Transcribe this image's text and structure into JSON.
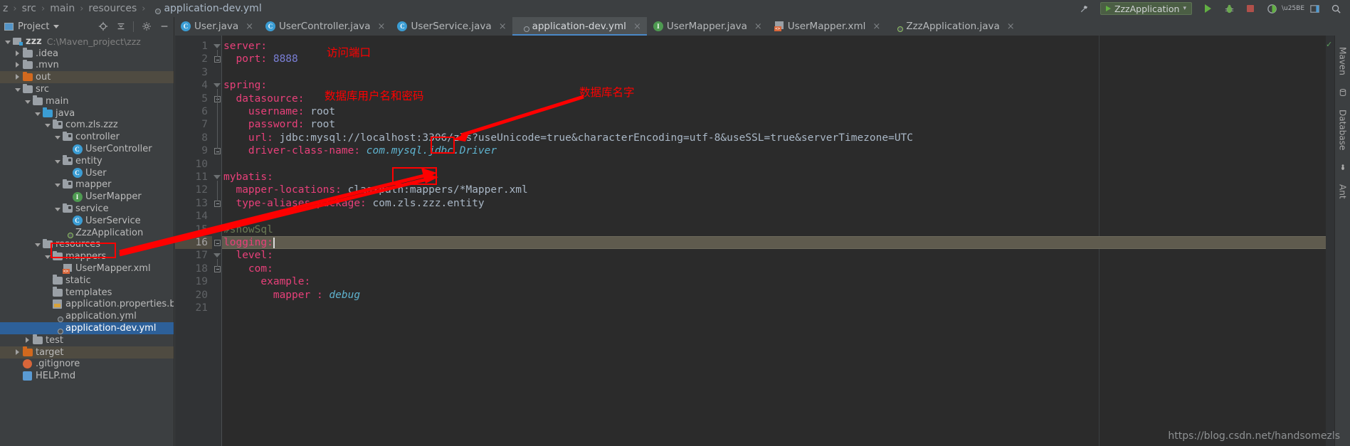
{
  "breadcrumb": {
    "items": [
      {
        "label": "z",
        "icon": "folder-icon",
        "dim": true
      },
      {
        "label": "src",
        "icon": "",
        "dim": true
      },
      {
        "label": "main",
        "icon": "",
        "dim": true
      },
      {
        "label": "resources",
        "icon": "",
        "dim": true
      },
      {
        "label": "application-dev.yml",
        "icon": "spring-yaml-icon",
        "dim": false
      }
    ],
    "separator": "›"
  },
  "titlebar_right": {
    "build_icon": "hammer-icon",
    "run_config": "ZzzApplication",
    "run_icon": "run-icon",
    "debug_icon": "debug-icon",
    "stop_icon": "stop-icon",
    "coverage_icon": "coverage-icon",
    "profile_icon": "profile-icon",
    "chevron": "▾",
    "layout_icon": "layout-icon",
    "search_icon": "search-icon"
  },
  "project_panel": {
    "title": "Project",
    "caret": "▾",
    "actions": [
      "locate-icon",
      "collapse-all-icon",
      "settings-icon",
      "hide-icon"
    ]
  },
  "tabs": [
    {
      "label": "User.java",
      "icon": "java-class-icon",
      "active": false,
      "close": "×"
    },
    {
      "label": "UserController.java",
      "icon": "java-class-icon",
      "active": false,
      "close": "×"
    },
    {
      "label": "UserService.java",
      "icon": "java-class-icon",
      "active": false,
      "close": "×"
    },
    {
      "label": "application-dev.yml",
      "icon": "spring-yaml-icon",
      "active": true,
      "close": "×"
    },
    {
      "label": "UserMapper.java",
      "icon": "java-interface-icon",
      "active": false,
      "close": "×"
    },
    {
      "label": "UserMapper.xml",
      "icon": "xml-icon",
      "active": false,
      "close": "×"
    },
    {
      "label": "ZzzApplication.java",
      "icon": "spring-app-icon",
      "active": false,
      "close": "×"
    }
  ],
  "tree": [
    {
      "indent": 0,
      "twisty": "down",
      "icon": "module-icon",
      "label": "zzz",
      "bold": true,
      "path": "C:\\Maven_project\\zzz",
      "state": ""
    },
    {
      "indent": 1,
      "twisty": "right",
      "icon": "folder-gray",
      "label": ".idea",
      "bold": false,
      "path": "",
      "state": ""
    },
    {
      "indent": 1,
      "twisty": "right",
      "icon": "folder-gray",
      "label": ".mvn",
      "bold": false,
      "path": "",
      "state": ""
    },
    {
      "indent": 1,
      "twisty": "right",
      "icon": "folder-orange",
      "label": "out",
      "bold": false,
      "path": "",
      "state": "sel-gray"
    },
    {
      "indent": 1,
      "twisty": "down",
      "icon": "folder-gray",
      "label": "src",
      "bold": false,
      "path": "",
      "state": ""
    },
    {
      "indent": 2,
      "twisty": "down",
      "icon": "folder-gray",
      "label": "main",
      "bold": false,
      "path": "",
      "state": ""
    },
    {
      "indent": 3,
      "twisty": "down",
      "icon": "folder-blue",
      "label": "java",
      "bold": false,
      "path": "",
      "state": ""
    },
    {
      "indent": 4,
      "twisty": "down",
      "icon": "package-icon",
      "label": "com.zls.zzz",
      "bold": false,
      "path": "",
      "state": ""
    },
    {
      "indent": 5,
      "twisty": "down",
      "icon": "package-icon",
      "label": "controller",
      "bold": false,
      "path": "",
      "state": ""
    },
    {
      "indent": 6,
      "twisty": "none",
      "icon": "java-class-icon",
      "label": "UserController",
      "bold": false,
      "path": "",
      "state": ""
    },
    {
      "indent": 5,
      "twisty": "down",
      "icon": "package-icon",
      "label": "entity",
      "bold": false,
      "path": "",
      "state": ""
    },
    {
      "indent": 6,
      "twisty": "none",
      "icon": "java-class-icon",
      "label": "User",
      "bold": false,
      "path": "",
      "state": ""
    },
    {
      "indent": 5,
      "twisty": "down",
      "icon": "package-icon",
      "label": "mapper",
      "bold": false,
      "path": "",
      "state": ""
    },
    {
      "indent": 6,
      "twisty": "none",
      "icon": "java-interface-icon",
      "label": "UserMapper",
      "bold": false,
      "path": "",
      "state": ""
    },
    {
      "indent": 5,
      "twisty": "down",
      "icon": "package-icon",
      "label": "service",
      "bold": false,
      "path": "",
      "state": ""
    },
    {
      "indent": 6,
      "twisty": "none",
      "icon": "java-class-icon",
      "label": "UserService",
      "bold": false,
      "path": "",
      "state": ""
    },
    {
      "indent": 5,
      "twisty": "none",
      "icon": "spring-app-icon",
      "label": "ZzzApplication",
      "bold": false,
      "path": "",
      "state": ""
    },
    {
      "indent": 3,
      "twisty": "down",
      "icon": "resources-icon",
      "label": "resources",
      "bold": false,
      "path": "",
      "state": ""
    },
    {
      "indent": 4,
      "twisty": "down",
      "icon": "folder-gray",
      "label": "mappers",
      "bold": false,
      "path": "",
      "state": ""
    },
    {
      "indent": 5,
      "twisty": "none",
      "icon": "xml-icon",
      "label": "UserMapper.xml",
      "bold": false,
      "path": "",
      "state": ""
    },
    {
      "indent": 4,
      "twisty": "none",
      "icon": "folder-gray",
      "label": "static",
      "bold": false,
      "path": "",
      "state": ""
    },
    {
      "indent": 4,
      "twisty": "none",
      "icon": "folder-gray",
      "label": "templates",
      "bold": false,
      "path": "",
      "state": ""
    },
    {
      "indent": 4,
      "twisty": "none",
      "icon": "properties-icon",
      "label": "application.properties.bak",
      "bold": false,
      "path": "",
      "state": ""
    },
    {
      "indent": 4,
      "twisty": "none",
      "icon": "spring-yaml-icon",
      "label": "application.yml",
      "bold": false,
      "path": "",
      "state": ""
    },
    {
      "indent": 4,
      "twisty": "none",
      "icon": "spring-yaml-icon",
      "label": "application-dev.yml",
      "bold": false,
      "path": "",
      "state": "sel-active"
    },
    {
      "indent": 2,
      "twisty": "right",
      "icon": "folder-gray",
      "label": "test",
      "bold": false,
      "path": "",
      "state": ""
    },
    {
      "indent": 1,
      "twisty": "right",
      "icon": "folder-orange",
      "label": "target",
      "bold": false,
      "path": "",
      "state": "sel-gray"
    },
    {
      "indent": 1,
      "twisty": "none",
      "icon": "git-icon",
      "label": ".gitignore",
      "bold": false,
      "path": "",
      "state": ""
    },
    {
      "indent": 1,
      "twisty": "none",
      "icon": "help-icon",
      "label": "HELP.md",
      "bold": false,
      "path": "",
      "state": ""
    }
  ],
  "code": {
    "lines": [
      {
        "n": "1",
        "fold": "tri",
        "tokens": [
          {
            "t": "server:",
            "c": "k-key"
          }
        ]
      },
      {
        "n": "2",
        "fold": "box",
        "tokens": [
          {
            "t": "  port: ",
            "c": "k-key"
          },
          {
            "t": "8888",
            "c": "k-num"
          }
        ]
      },
      {
        "n": "3",
        "fold": "",
        "tokens": []
      },
      {
        "n": "4",
        "fold": "tri",
        "tokens": [
          {
            "t": "spring:",
            "c": "k-key"
          }
        ]
      },
      {
        "n": "5",
        "fold": "box",
        "tokens": [
          {
            "t": "  datasource:",
            "c": "k-key"
          }
        ]
      },
      {
        "n": "6",
        "fold": "",
        "tokens": [
          {
            "t": "    username: ",
            "c": "k-key"
          },
          {
            "t": "root",
            "c": "k-val"
          }
        ]
      },
      {
        "n": "7",
        "fold": "",
        "tokens": [
          {
            "t": "    password: ",
            "c": "k-key"
          },
          {
            "t": "root",
            "c": "k-val"
          }
        ]
      },
      {
        "n": "8",
        "fold": "",
        "tokens": [
          {
            "t": "    url: ",
            "c": "k-key"
          },
          {
            "t": "jdbc:mysql://localhost:3306/zls?useUnicode=true&characterEncoding=utf-8&useSSL=true&serverTimezone=UTC",
            "c": "k-val"
          }
        ]
      },
      {
        "n": "9",
        "fold": "box",
        "tokens": [
          {
            "t": "    driver-class-name: ",
            "c": "k-key"
          },
          {
            "t": "com.mysql.jdbc.Driver",
            "c": "k-cls"
          }
        ]
      },
      {
        "n": "10",
        "fold": "",
        "tokens": []
      },
      {
        "n": "11",
        "fold": "tri",
        "tokens": [
          {
            "t": "mybatis:",
            "c": "k-key"
          }
        ]
      },
      {
        "n": "12",
        "fold": "",
        "tokens": [
          {
            "t": "  mapper-locations: ",
            "c": "k-key"
          },
          {
            "t": "classpath:mappers/*Mapper.xml",
            "c": "k-val"
          }
        ]
      },
      {
        "n": "13",
        "fold": "box",
        "tokens": [
          {
            "t": "  type-aliases-package: ",
            "c": "k-key"
          },
          {
            "t": "com.zls.zzz.entity",
            "c": "k-val"
          }
        ]
      },
      {
        "n": "14",
        "fold": "",
        "tokens": []
      },
      {
        "n": "15",
        "fold": "",
        "tokens": [
          {
            "t": "#showSql",
            "c": "k-com"
          }
        ]
      },
      {
        "n": "16",
        "fold": "boxm",
        "tokens": [
          {
            "t": "logging:",
            "c": "k-key"
          }
        ],
        "current": true
      },
      {
        "n": "17",
        "fold": "tri",
        "tokens": [
          {
            "t": "  level:",
            "c": "k-key"
          }
        ]
      },
      {
        "n": "18",
        "fold": "box",
        "tokens": [
          {
            "t": "    com:",
            "c": "k-key"
          }
        ]
      },
      {
        "n": "19",
        "fold": "",
        "tokens": [
          {
            "t": "      example:",
            "c": "k-key"
          }
        ]
      },
      {
        "n": "20",
        "fold": "",
        "tokens": [
          {
            "t": "        mapper : ",
            "c": "k-key"
          },
          {
            "t": "debug",
            "c": "k-cls"
          }
        ]
      },
      {
        "n": "21",
        "fold": "",
        "tokens": []
      }
    ]
  },
  "annotations": [
    {
      "id": "anno-port",
      "text": "访问端口"
    },
    {
      "id": "anno-userpass",
      "text": "数据库用户名和密码"
    },
    {
      "id": "anno-dbname",
      "text": "数据库名字"
    }
  ],
  "right_rail": {
    "items": [
      "Maven",
      "Database",
      "Ant"
    ]
  },
  "watermark": "https://blog.csdn.net/handsomezls",
  "colors": {
    "accent_blue": "#2d6099",
    "annotation_red": "#ff0000",
    "yaml_key": "#e8407a",
    "number": "#7a7fd6",
    "class_ref": "#5fb3cf",
    "comment": "#6a7a55",
    "editor_bg": "#2b2b2b",
    "panel_bg": "#3c3f41"
  }
}
